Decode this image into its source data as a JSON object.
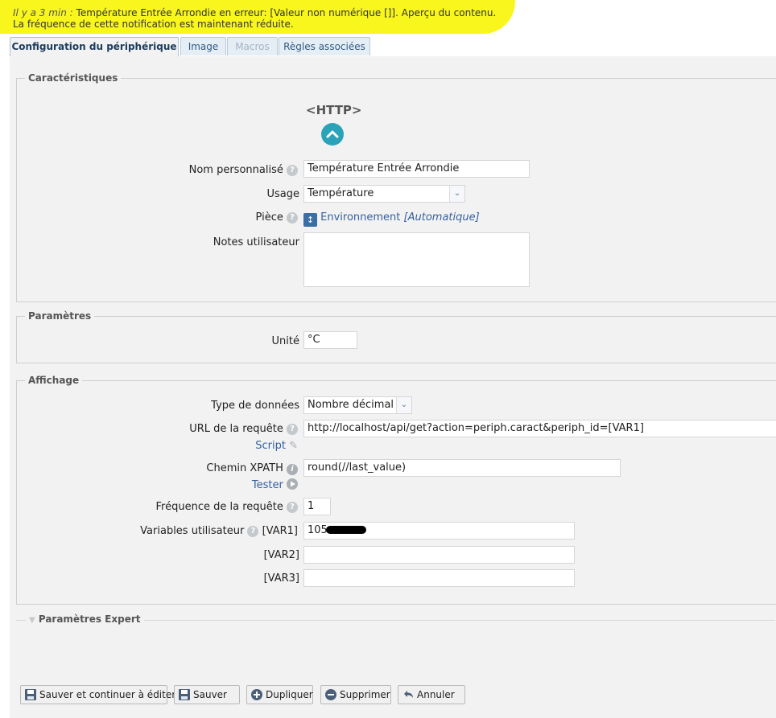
{
  "notification": {
    "time": "Il y a 3 min",
    "message": "Température Entrée Arrondie en erreur: [Valeur non numérique []]. Aperçu du contenu.",
    "note": "La fréquence de cette notification est maintenant réduite."
  },
  "tabs": [
    {
      "label": "Configuration du périphérique",
      "state": "active"
    },
    {
      "label": "Image",
      "state": "normal"
    },
    {
      "label": "Macros",
      "state": "disabled"
    },
    {
      "label": "Règles associées",
      "state": "normal"
    }
  ],
  "sections": {
    "caracteristiques": "Caractéristiques",
    "parametres": "Paramètres",
    "affichage": "Affichage",
    "expert": "Paramètres Expert"
  },
  "device": {
    "type_label": "<HTTP>",
    "name_label": "Nom personnalisé",
    "name_value": "Température Entrée Arrondie",
    "usage_label": "Usage",
    "usage_value": "Température",
    "room_label": "Pièce",
    "room_value": "Environnement",
    "room_mode": "[Automatique]",
    "notes_label": "Notes utilisateur",
    "notes_value": ""
  },
  "params": {
    "unit_label": "Unité",
    "unit_value": "°C"
  },
  "display": {
    "datatype_label": "Type de données",
    "datatype_value": "Nombre décimal",
    "url_label": "URL de la requête",
    "url_value": "http://localhost/api/get?action=periph.caract&periph_id=[VAR1]",
    "script_link": "Script",
    "xpath_label": "Chemin XPATH",
    "xpath_value": "round(//last_value)",
    "test_link": "Tester",
    "freq_label": "Fréquence de la requête",
    "freq_value": "1",
    "vars_label": "Variables utilisateur",
    "var1_label": "[VAR1]",
    "var1_value": "105",
    "var2_label": "[VAR2]",
    "var2_value": "",
    "var3_label": "[VAR3]",
    "var3_value": ""
  },
  "buttons": {
    "save_continue": "Sauver et continuer à éditer",
    "save": "Sauver",
    "duplicate": "Dupliquer",
    "delete": "Supprimer",
    "cancel": "Annuler"
  },
  "colors": {
    "highlight": "#f8f61c",
    "link": "#3561a3",
    "accent": "#2aa3b8"
  }
}
